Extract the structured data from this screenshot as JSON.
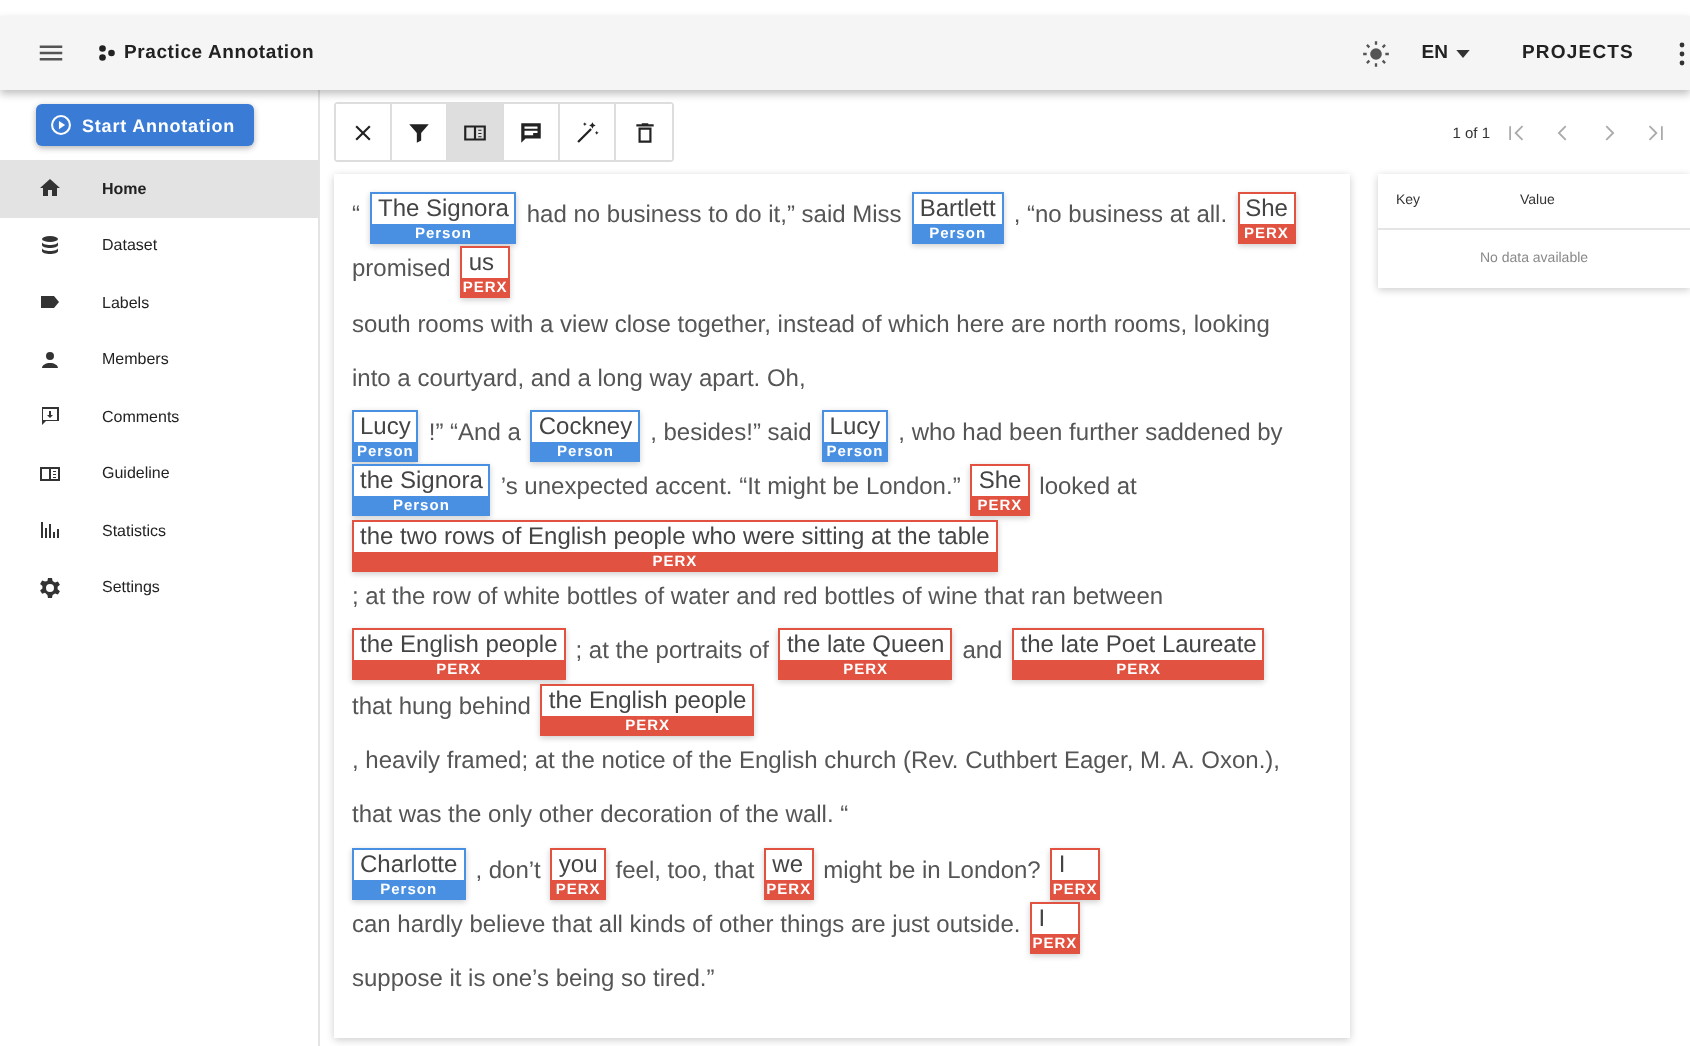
{
  "app_bar": {
    "title": "Practice Annotation",
    "language": "EN",
    "projects": "PROJECTS"
  },
  "start_button": "Start Annotation",
  "sidebar": {
    "items": [
      {
        "label": "Home",
        "selected": true
      },
      {
        "label": "Dataset",
        "selected": false
      },
      {
        "label": "Labels",
        "selected": false
      },
      {
        "label": "Members",
        "selected": false
      },
      {
        "label": "Comments",
        "selected": false
      },
      {
        "label": "Guideline",
        "selected": false
      },
      {
        "label": "Statistics",
        "selected": false
      },
      {
        "label": "Settings",
        "selected": false
      }
    ]
  },
  "toolbar": [
    {
      "selected": false
    },
    {
      "selected": false
    },
    {
      "selected": true
    },
    {
      "selected": false
    },
    {
      "selected": false
    },
    {
      "selected": false
    }
  ],
  "pagination": {
    "text": "1 of 1"
  },
  "document": {
    "lines": [
      [
        {
          "text": "“"
        },
        {
          "text": "The Signora",
          "label": "Person",
          "color": "#4a90e2"
        },
        {
          "text": "had no business to do it,” said Miss"
        },
        {
          "text": "Bartlett",
          "label": "Person",
          "color": "#4a90e2"
        },
        {
          "text": ", “no business at all."
        },
        {
          "text": "She",
          "label": "PERX",
          "color": "#e25241"
        }
      ],
      [
        {
          "text": "promised"
        },
        {
          "text": "us",
          "label": "PERX",
          "color": "#e25241"
        }
      ],
      [
        {
          "text": "south rooms with a view close together, instead of which here are north rooms, looking"
        }
      ],
      [
        {
          "text": "into a courtyard, and a long way apart. Oh,"
        }
      ],
      [
        {
          "text": "Lucy",
          "label": "Person",
          "color": "#4a90e2"
        },
        {
          "text": "!” “And a"
        },
        {
          "text": "Cockney",
          "label": "Person",
          "color": "#4a90e2"
        },
        {
          "text": ", besides!” said"
        },
        {
          "text": "Lucy",
          "label": "Person",
          "color": "#4a90e2"
        },
        {
          "text": ", who had been further saddened by"
        }
      ],
      [
        {
          "text": "the Signora",
          "label": "Person",
          "color": "#4a90e2"
        },
        {
          "text": "’s unexpected accent. “It might be London.”"
        },
        {
          "text": "She",
          "label": "PERX",
          "color": "#e25241"
        },
        {
          "text": "looked at"
        }
      ],
      [
        {
          "text": "the two rows of English people who were sitting at the table",
          "label": "PERX",
          "color": "#e25241"
        }
      ],
      [
        {
          "text": "; at the row of white bottles of water and red bottles of wine that ran between"
        }
      ],
      [
        {
          "text": "the English people",
          "label": "PERX",
          "color": "#e25241"
        },
        {
          "text": "; at the portraits of"
        },
        {
          "text": "the late Queen",
          "label": "PERX",
          "color": "#e25241"
        },
        {
          "text": "and"
        },
        {
          "text": "the late Poet Laureate",
          "label": "PERX",
          "color": "#e25241"
        }
      ],
      [
        {
          "text": "that hung behind"
        },
        {
          "text": "the English people",
          "label": "PERX",
          "color": "#e25241"
        }
      ],
      [
        {
          "text": ", heavily framed; at the notice of the English church (Rev. Cuthbert Eager, M. A. Oxon.),"
        }
      ],
      [
        {
          "text": "that was the only other decoration of the wall. “"
        }
      ],
      [
        {
          "text": "Charlotte",
          "label": "Person",
          "color": "#4a90e2"
        },
        {
          "text": ", don’t"
        },
        {
          "text": "you",
          "label": "PERX",
          "color": "#e25241"
        },
        {
          "text": "feel, too, that"
        },
        {
          "text": "we",
          "label": "PERX",
          "color": "#e25241"
        },
        {
          "text": "might be in London?"
        },
        {
          "text": "I",
          "label": "PERX",
          "color": "#e25241"
        }
      ],
      [
        {
          "text": "can hardly believe that all kinds of other things are just outside."
        },
        {
          "text": "I",
          "label": "PERX",
          "color": "#e25241"
        }
      ],
      [
        {
          "text": "suppose it is one’s being so tired.”"
        }
      ]
    ]
  },
  "metadata_table": {
    "columns": [
      "Key",
      "Value"
    ],
    "empty_text": "No data available"
  }
}
